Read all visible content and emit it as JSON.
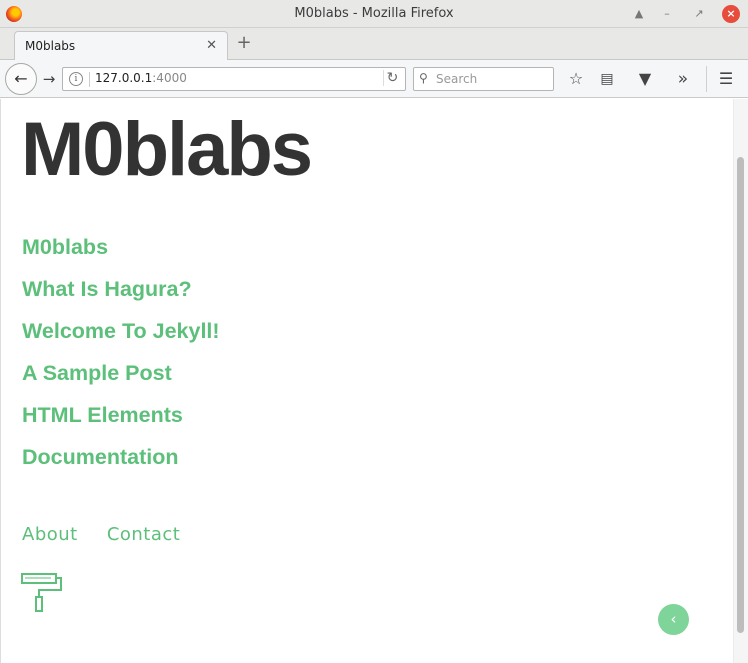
{
  "window": {
    "title": "M0blabs - Mozilla Firefox"
  },
  "tab": {
    "label": "M0blabs"
  },
  "navbar": {
    "url_host": "127.0.0.1",
    "url_port": ":4000",
    "search_placeholder": "Search"
  },
  "page": {
    "site_title": "M0blabs",
    "posts": [
      "M0blabs",
      "What Is Hagura?",
      "Welcome To Jekyll!",
      "A Sample Post",
      "HTML Elements",
      "Documentation"
    ],
    "nav_links": [
      "About",
      "Contact"
    ]
  },
  "icons": {
    "window_up": "triangle-up-icon",
    "window_min": "minimize-icon",
    "window_max": "maximize-icon",
    "window_close": "close-icon",
    "back": "back-arrow-icon",
    "forward": "forward-arrow-icon",
    "reload": "reload-icon",
    "search": "search-icon",
    "bookmark": "star-icon",
    "reader": "reader-view-icon",
    "pocket": "pocket-icon",
    "overflow": "chevron-double-right-icon",
    "menu": "hamburger-menu-icon",
    "logo": "paint-roller-icon",
    "back_to_top": "chevron-left-icon"
  },
  "colors": {
    "accent": "#5cbf7a",
    "title_text": "#333333",
    "back_to_top_bg": "#7fd49a",
    "close_button": "#e74c3c"
  }
}
